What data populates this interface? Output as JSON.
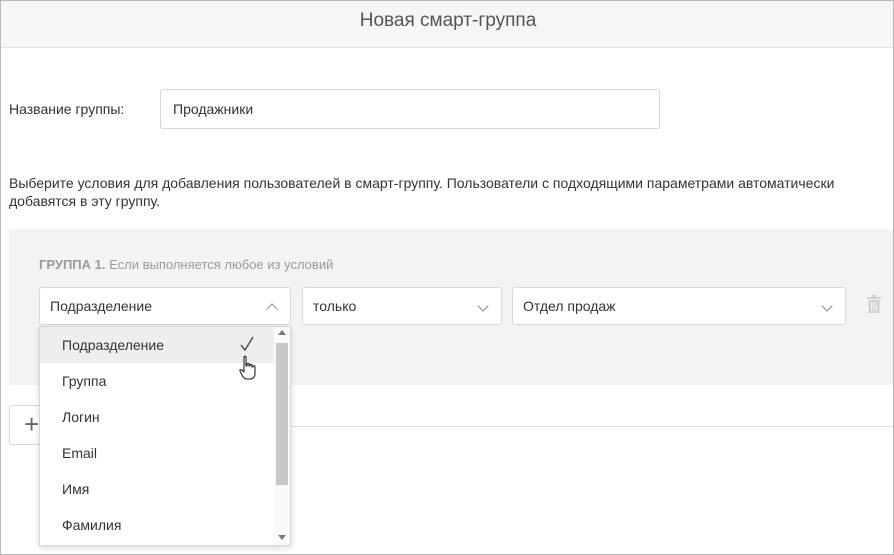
{
  "header": {
    "title": "Новая смарт-группа"
  },
  "form": {
    "name_label": "Название группы:",
    "name_value": "Продажники",
    "description": "Выберите условия для добавления пользователей в смарт-группу. Пользователи с подходящими параметрами автоматически добавятся в эту группу."
  },
  "group": {
    "title_bold": "ГРУППА 1.",
    "title_rest": "Если выполняется любое из условий",
    "condition": {
      "field": "Подразделение",
      "operator": "только",
      "value": "Отдел продаж"
    }
  },
  "add_button": {
    "label": "+"
  },
  "dropdown": {
    "selected": "Подразделение",
    "items": [
      "Подразделение",
      "Группа",
      "Логин",
      "Email",
      "Имя",
      "Фамилия"
    ]
  }
}
